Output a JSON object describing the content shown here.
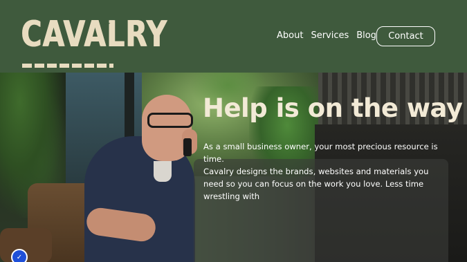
{
  "header": {
    "logo_text": "CAVALRY",
    "nav": [
      "About",
      "Services",
      "Blog"
    ],
    "contact_label": "Contact"
  },
  "hero": {
    "title": "Help is on the way",
    "paragraph1": "As a small business owner, your most precious resource is time.",
    "paragraph2": "Cavalry designs the brands, websites and materials you need so you can focus on the work you love. Less time wrestling with"
  },
  "icons": {
    "logo_star": "star-icon",
    "badge": "shield-check-icon"
  },
  "colors": {
    "header_bg": "#3f5a3d",
    "logo": "#e8dcc0",
    "hero_title": "#f2ead6",
    "badge": "#1e4fd8"
  }
}
